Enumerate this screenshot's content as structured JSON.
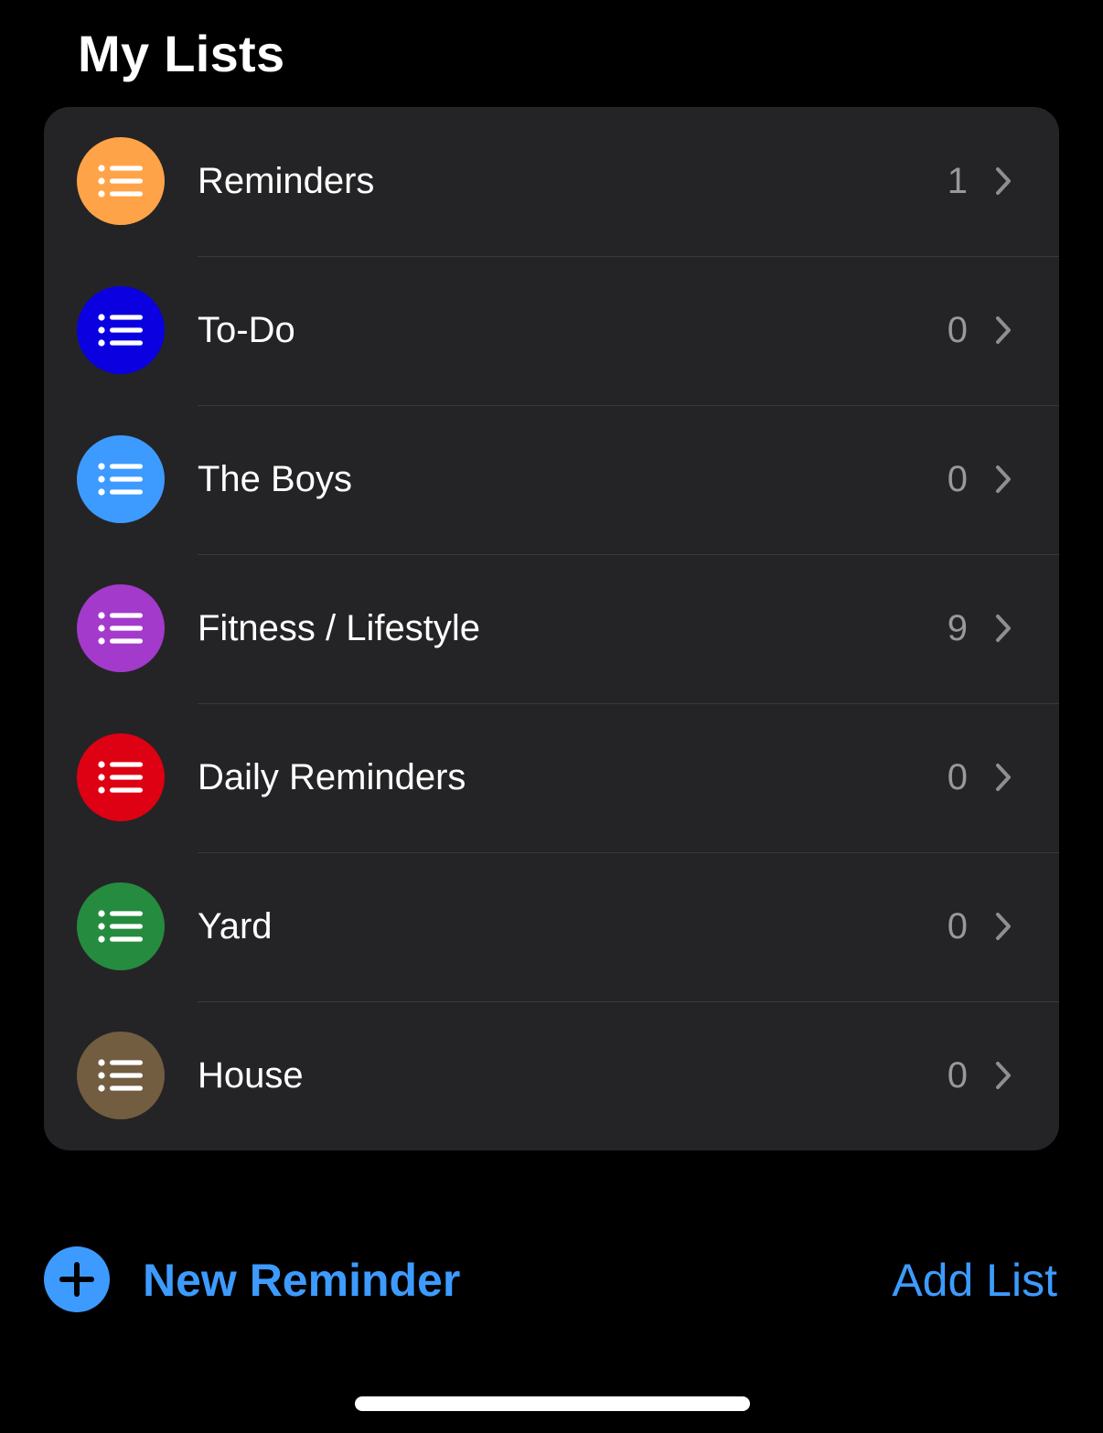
{
  "header": {
    "title": "My Lists"
  },
  "lists": [
    {
      "name": "Reminders",
      "count": "1",
      "color": "#ffa348",
      "icon": "list-bullet-icon"
    },
    {
      "name": "To-Do",
      "count": "0",
      "color": "#0a00e0",
      "icon": "list-bullet-icon"
    },
    {
      "name": "The Boys",
      "count": "0",
      "color": "#3d9bff",
      "icon": "list-bullet-icon"
    },
    {
      "name": "Fitness / Lifestyle",
      "count": "9",
      "color": "#a33acb",
      "icon": "list-bullet-icon"
    },
    {
      "name": "Daily Reminders",
      "count": "0",
      "color": "#de0013",
      "icon": "list-bullet-icon"
    },
    {
      "name": "Yard",
      "count": "0",
      "color": "#258b3f",
      "icon": "list-bullet-icon"
    },
    {
      "name": "House",
      "count": "0",
      "color": "#725d40",
      "icon": "list-bullet-icon"
    }
  ],
  "toolbar": {
    "new_reminder_label": "New Reminder",
    "new_reminder_icon": "plus-circle-icon",
    "add_list_label": "Add List",
    "accent_color": "#3d9bff"
  },
  "colors": {
    "background": "#000000",
    "card": "#242426",
    "secondary_text": "#98989d"
  }
}
